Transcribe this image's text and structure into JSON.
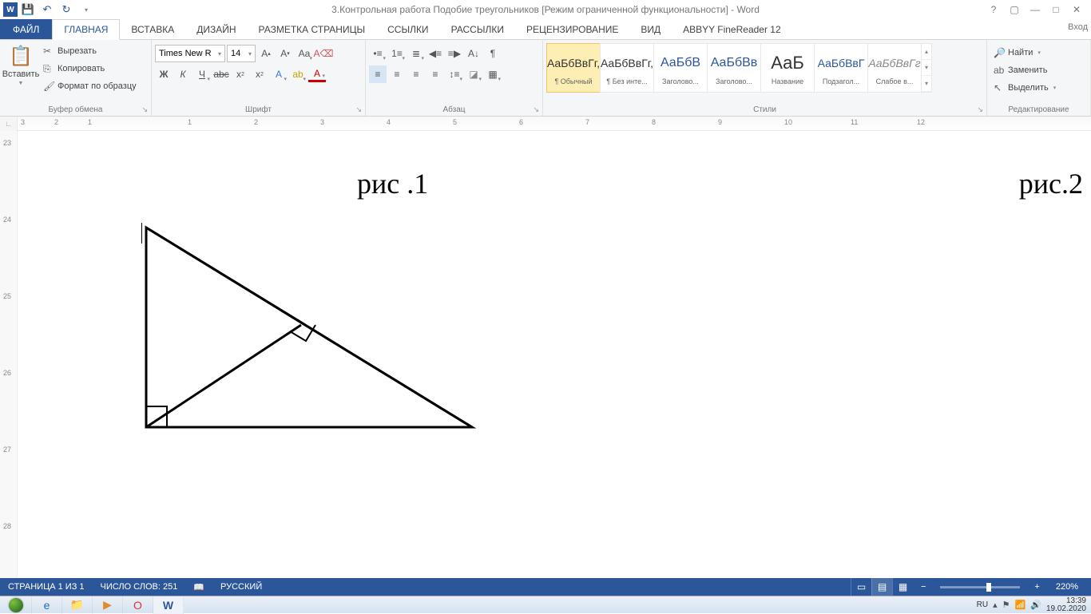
{
  "titlebar": {
    "title": "3.Контрольная работа Подобие треугольников [Режим ограниченной функциональности] - Word",
    "login": "Вход"
  },
  "tabs": {
    "file": "ФАЙЛ",
    "items": [
      "ГЛАВНАЯ",
      "ВСТАВКА",
      "ДИЗАЙН",
      "РАЗМЕТКА СТРАНИЦЫ",
      "ССЫЛКИ",
      "РАССЫЛКИ",
      "РЕЦЕНЗИРОВАНИЕ",
      "ВИД",
      "ABBYY FineReader 12"
    ]
  },
  "ribbon": {
    "clipboard": {
      "paste": "Вставить",
      "cut": "Вырезать",
      "copy": "Копировать",
      "format_painter": "Формат по образцу",
      "label": "Буфер обмена"
    },
    "font": {
      "name": "Times New R",
      "size": "14",
      "label": "Шрифт",
      "bold": "Ж",
      "italic": "К",
      "underline": "Ч"
    },
    "paragraph": {
      "label": "Абзац"
    },
    "styles": {
      "label": "Стили",
      "items": [
        {
          "preview": "АаБбВвГг,",
          "name": "¶ Обычный",
          "cls": ""
        },
        {
          "preview": "АаБбВвГг,",
          "name": "¶ Без инте...",
          "cls": ""
        },
        {
          "preview": "АаБбВ",
          "name": "Заголово...",
          "cls": "med"
        },
        {
          "preview": "АаБбВв",
          "name": "Заголово...",
          "cls": "med"
        },
        {
          "preview": "АаБ",
          "name": "Название",
          "cls": "big"
        },
        {
          "preview": "АаБбВвГ",
          "name": "Подзагол...",
          "cls": "blue"
        },
        {
          "preview": "АаБбВвГг",
          "name": "Слабое в...",
          "cls": ""
        }
      ]
    },
    "editing": {
      "find": "Найти",
      "replace": "Заменить",
      "select": "Выделить",
      "label": "Редактирование"
    }
  },
  "ruler": {
    "ticks": [
      "3",
      "2",
      "1",
      "",
      "1",
      "2",
      "3",
      "4",
      "5",
      "6",
      "7",
      "8",
      "9",
      "10",
      "11",
      "12"
    ]
  },
  "vruler": {
    "ticks": [
      "23",
      "24",
      "25",
      "26",
      "27",
      "28"
    ]
  },
  "document": {
    "fig1": "рис .1",
    "fig2": "рис.2"
  },
  "statusbar": {
    "page": "СТРАНИЦА 1 ИЗ 1",
    "words": "ЧИСЛО СЛОВ: 251",
    "lang": "РУССКИЙ",
    "zoom": "220%"
  },
  "taskbar": {
    "lang": "RU",
    "time": "13:39",
    "date": "19.02.2020"
  }
}
